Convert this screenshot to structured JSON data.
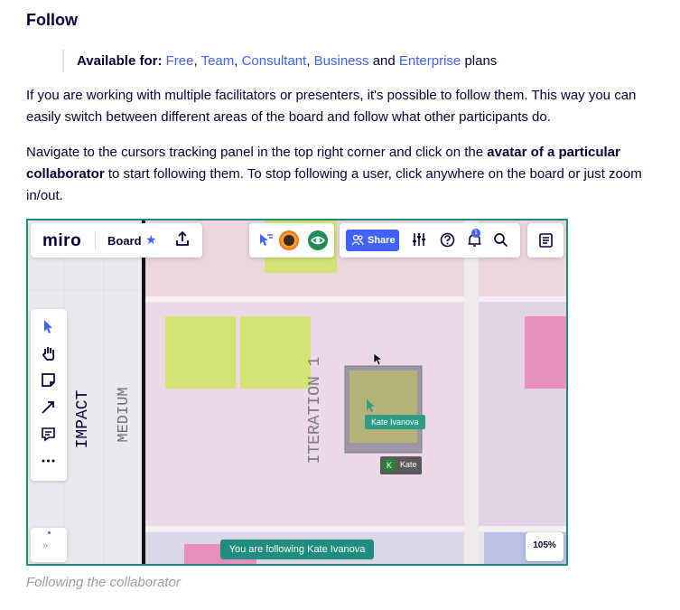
{
  "article": {
    "heading": "Follow",
    "availability": {
      "prefix": "Available for:",
      "plans": [
        "Free",
        "Team",
        "Consultant",
        "Business",
        "Enterprise"
      ],
      "sep": ", ",
      "and": " and ",
      "suffix": " plans"
    },
    "paragraph1": "If you are working with multiple facilitators or presenters, it's possible to follow them. This way you can easily switch between different areas of the board and follow what other participants do.",
    "paragraph2": {
      "part1": "Navigate to the cursors tracking panel in the top right corner and click on the ",
      "bold": "avatar of a particular collaborator",
      "part2": " to start following them. To stop following a user, click anywhere on the board or just zoom in/out."
    },
    "caption": "Following the collaborator"
  },
  "screenshot": {
    "logo": "miro",
    "board_label": "Board",
    "share_label": "Share",
    "notification_count": "1",
    "zoom_level": "105%",
    "expand_label": "»",
    "follow_banner": "You are following Kate Ivanova",
    "cursor_label": "Kate Ivanova",
    "collaborator_initial": "K",
    "collaborator_name": "Kate",
    "board_labels": {
      "impact": "IMPACT",
      "medium": "MEDIUM",
      "iteration": "ITERATION 1"
    },
    "colors": {
      "accent": "#4262ff",
      "follow_frame": "#1f8c7d",
      "sticky_yellow": "#d2e371",
      "sticky_pink": "#e88fbe"
    }
  }
}
